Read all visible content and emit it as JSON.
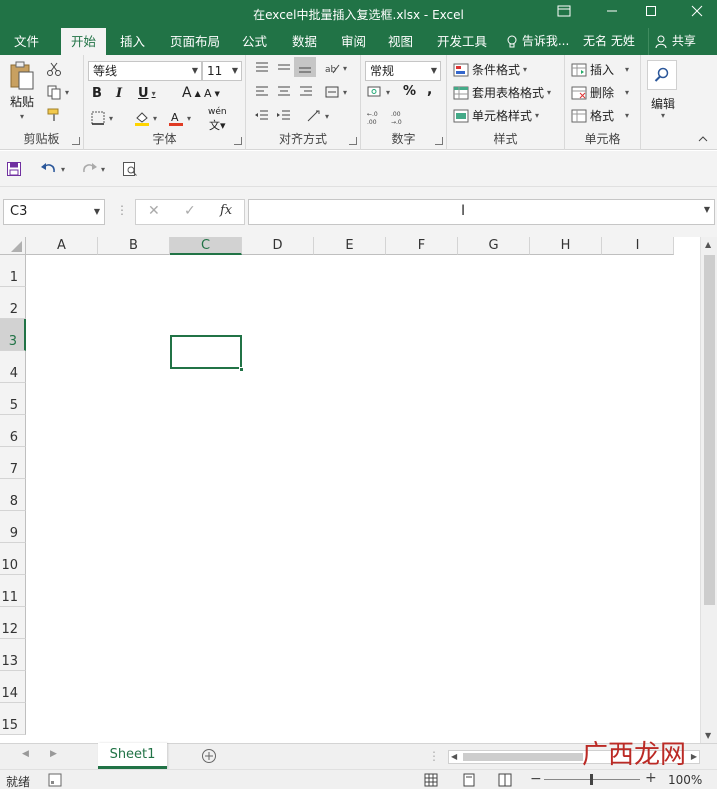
{
  "window": {
    "title": "在excel中批量插入复选框.xlsx - Excel",
    "minimize_icon": "minimize-icon",
    "restore_icon": "restore-icon",
    "close_icon": "close-icon",
    "ribbon_display_icon": "ribbon-display-icon"
  },
  "ribbon_tabs": [
    "文件",
    "开始",
    "插入",
    "页面布局",
    "公式",
    "数据",
    "审阅",
    "视图",
    "开发工具"
  ],
  "active_tab": "开始",
  "tell_me": "告诉我...",
  "user_name": "无名 无姓",
  "share_label": "共享",
  "groups": {
    "clipboard": {
      "label": "剪贴板",
      "paste": "粘贴"
    },
    "font": {
      "label": "字体",
      "font_name": "等线",
      "font_size": "11",
      "bold": "B",
      "italic": "I",
      "underline": "U",
      "grow": "A",
      "shrink": "A",
      "wen": "wén"
    },
    "alignment": {
      "label": "对齐方式"
    },
    "number": {
      "label": "数字",
      "format": "常规",
      "percent": "%",
      "comma": ","
    },
    "styles": {
      "label": "样式",
      "conditional": "条件格式",
      "table": "套用表格格式",
      "cell_styles": "单元格样式"
    },
    "cells": {
      "label": "单元格",
      "insert": "插入",
      "delete": "删除",
      "format": "格式"
    },
    "editing": {
      "label": "编辑"
    }
  },
  "formula_bar": {
    "name_box": "C3",
    "cancel": "✕",
    "enter": "✓",
    "fx": "fx",
    "formula": ""
  },
  "columns": [
    "A",
    "B",
    "C",
    "D",
    "E",
    "F",
    "G",
    "H",
    "I"
  ],
  "rows": [
    "1",
    "2",
    "3",
    "4",
    "5",
    "6",
    "7",
    "8",
    "9",
    "10",
    "11",
    "12",
    "13",
    "14",
    "15"
  ],
  "selected_cell": {
    "column": "C",
    "row": "3"
  },
  "sheets": [
    "Sheet1"
  ],
  "active_sheet": "Sheet1",
  "status": {
    "ready": "就绪",
    "zoom": "100%"
  },
  "watermark": "广西龙网",
  "colors": {
    "accent": "#217346",
    "ribbon_bg": "#f3f3f3"
  }
}
